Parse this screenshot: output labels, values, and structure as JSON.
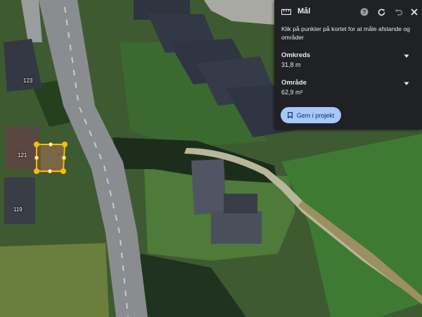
{
  "map": {
    "house_numbers": [
      "123",
      "121",
      "119"
    ]
  },
  "measure_panel": {
    "title": "Mål",
    "icons": [
      "ruler-icon",
      "help-icon",
      "refresh-icon",
      "undo-icon",
      "close-icon",
      "chevron-down-icon",
      "bookmark-icon"
    ],
    "instructions": "Klik på punkter på kortet for at måle afstande og områder",
    "perimeter": {
      "label": "Omkreds",
      "value": "31,8 m"
    },
    "area": {
      "label": "Område",
      "value": "62,9 m²"
    },
    "save_button_label": "Gem i projekt"
  },
  "colors": {
    "panel_bg": "#202124",
    "panel_text": "#e8eaed",
    "button_bg": "#a8c7fa",
    "button_text": "#062e6f",
    "measure_line": "#fbbc04"
  }
}
